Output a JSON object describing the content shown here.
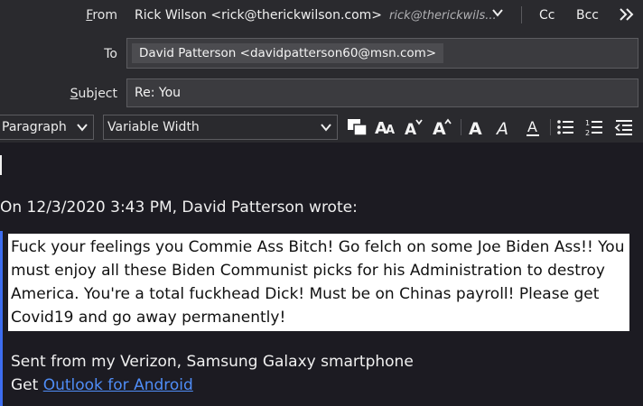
{
  "header": {
    "from_label_prefix": "F",
    "from_label_rest": "rom",
    "from_value": "Rick Wilson <rick@therickwilson.com>",
    "from_identity": "rick@therickwils...",
    "cc_label": "Cc",
    "bcc_label": "Bcc",
    "to_label": "To",
    "to_recipient": "David Patterson <davidpatterson60@msn.com>",
    "subject_label_prefix": "S",
    "subject_label_rest": "ubject",
    "subject_value": "Re: You"
  },
  "toolbar": {
    "paragraph_format": "Paragraph",
    "font_face": "Variable Width",
    "icons": [
      "text-color-icon",
      "smaller-font-icon",
      "larger-font-icon",
      "decrease-size-icon",
      "increase-size-icon",
      "bold-icon",
      "italic-icon",
      "underline-icon",
      "bullet-list-icon",
      "numbered-list-icon",
      "outdent-icon"
    ]
  },
  "message": {
    "attribution": "On 12/3/2020 3:43 PM, David Patterson wrote:",
    "quoted_text": "Fuck your feelings you Commie Ass Bitch! Go felch on some Joe Biden Ass!! You must enjoy all these Biden Communist picks for his Administration to destroy America. You're a total fuckhead Dick! Must be on Chinas payroll! Please get Covid19 and go away permanently!",
    "signature_line1": "Sent from my Verizon, Samsung Galaxy smartphone",
    "signature_get": "Get ",
    "signature_link": "Outlook for Android"
  },
  "colors": {
    "background": "#2a2a2e",
    "editor_background": "#1c1b22",
    "quote_bar": "#3d6df0",
    "link": "#4f8df7"
  }
}
